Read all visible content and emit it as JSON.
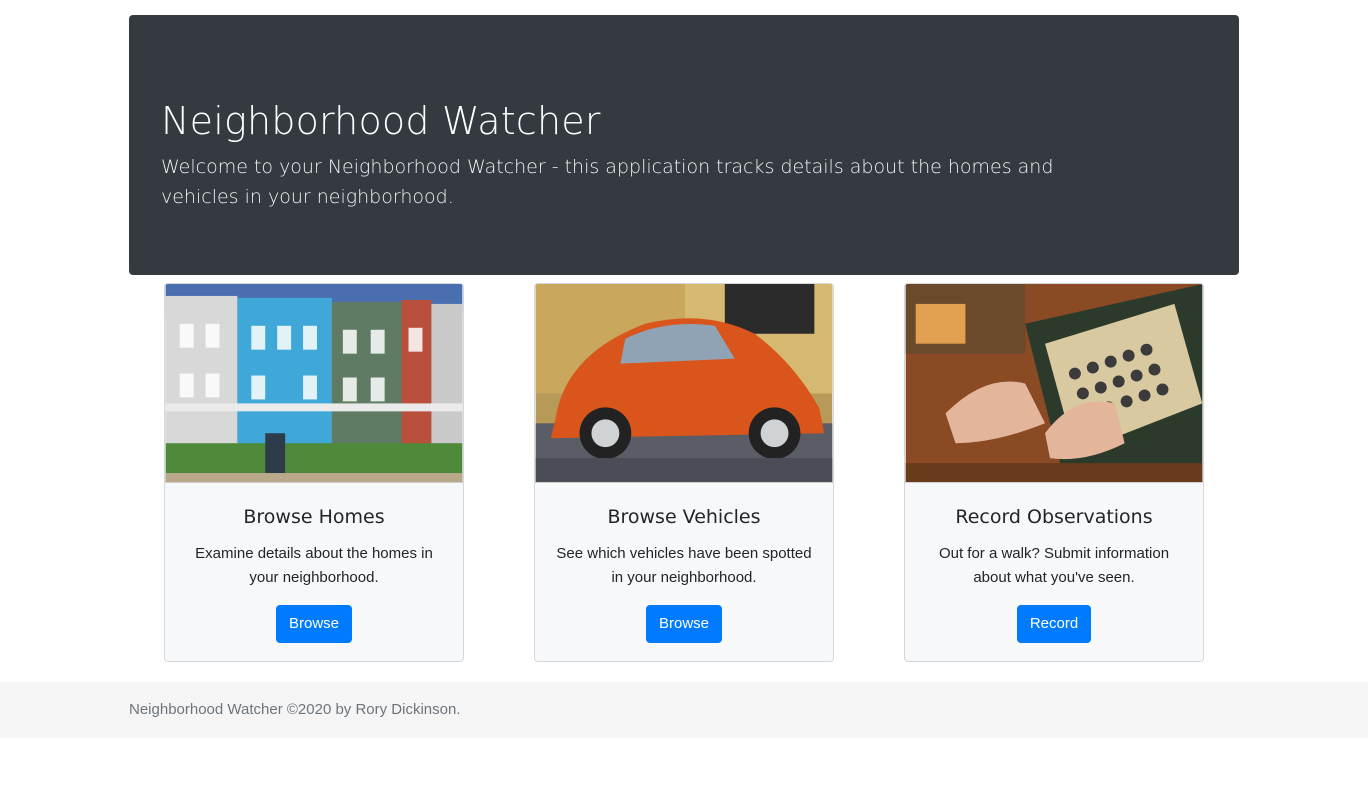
{
  "hero": {
    "title": "Neighborhood Watcher",
    "lead": "Welcome to your Neighborhood Watcher - this application tracks details about the homes and vehicles in your neighborhood."
  },
  "cards": [
    {
      "image": "row-houses-photo",
      "title": "Browse Homes",
      "text": "Examine details about the homes in your neighborhood.",
      "button": "Browse"
    },
    {
      "image": "orange-beetle-car-photo",
      "title": "Browse Vehicles",
      "text": "See which vehicles have been spotted in your neighborhood.",
      "button": "Browse"
    },
    {
      "image": "typewriter-hands-photo",
      "title": "Record Observations",
      "text": "Out for a walk? Submit information about what you've seen.",
      "button": "Record"
    }
  ],
  "footer": {
    "text": "Neighborhood Watcher ©2020 by Rory Dickinson."
  },
  "colors": {
    "hero_bg": "#343a40",
    "primary": "#007bff",
    "card_bg": "#f7f8fa",
    "footer_bg": "#f5f5f5"
  }
}
